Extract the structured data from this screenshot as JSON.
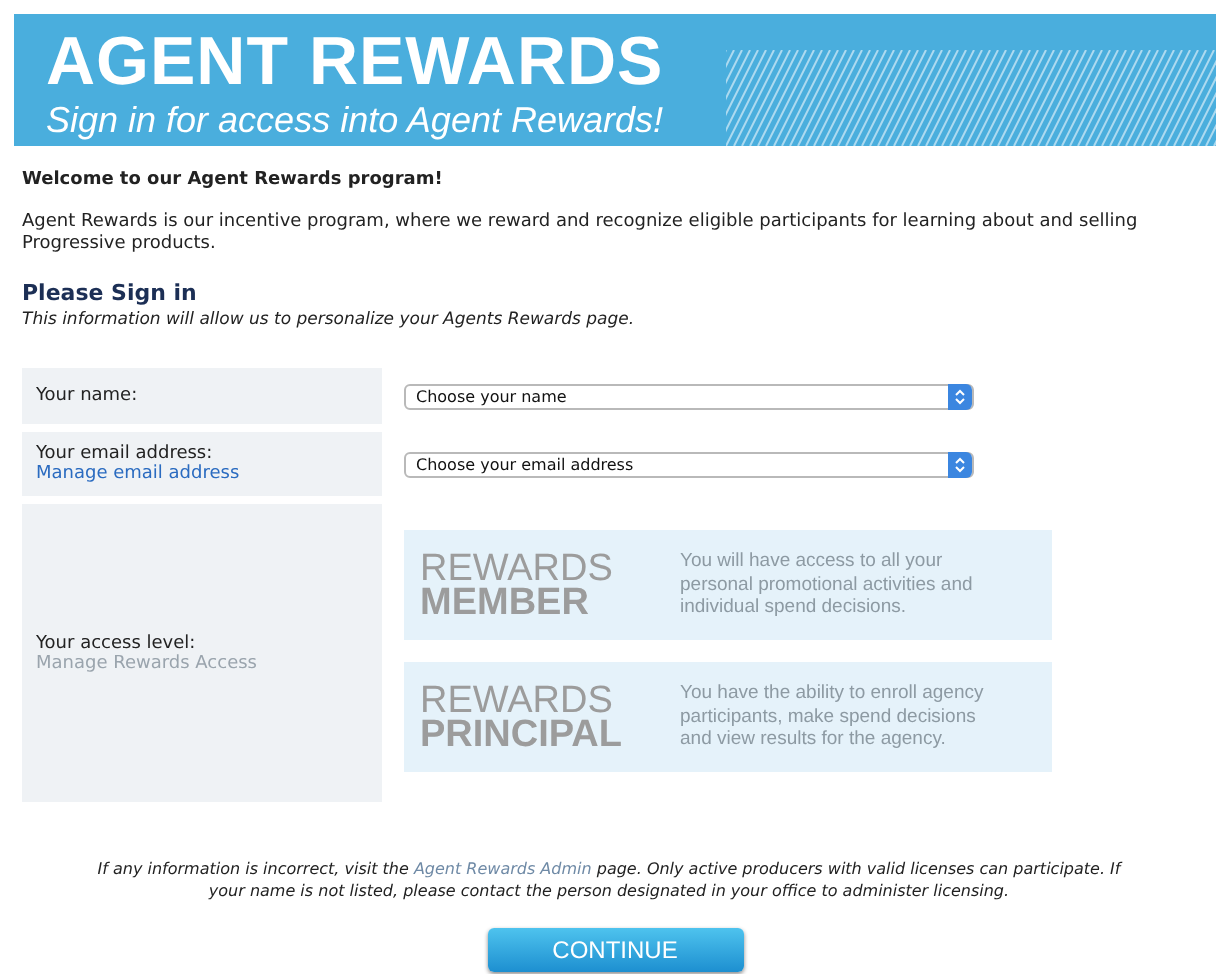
{
  "banner": {
    "title": "AGENT REWARDS",
    "subtitle": "Sign in for access into Agent Rewards!"
  },
  "welcome": "Welcome to our Agent Rewards program!",
  "intro": "Agent Rewards is our incentive program, where we reward and recognize eligible participants for learning about and selling Progressive products.",
  "sign_in": {
    "heading": "Please Sign in",
    "subheading": "This information will allow us to personalize your Agents Rewards page."
  },
  "form": {
    "name": {
      "label": "Your name:",
      "value": "Choose your name"
    },
    "email": {
      "label": "Your email address:",
      "link": "Manage email address",
      "value": "Choose your email address"
    },
    "access": {
      "label": "Your access level:",
      "link": "Manage Rewards Access",
      "link_disabled": true,
      "options": [
        {
          "title_light": "REWARDS",
          "title_bold": "MEMBER",
          "description": "You will have access to all your personal promotional activities and individual spend decisions.",
          "disabled": true
        },
        {
          "title_light": "REWARDS",
          "title_bold": "PRINCIPAL",
          "description": "You have the ability to enroll agency participants, make spend decisions and view results for the agency.",
          "disabled": true
        }
      ]
    }
  },
  "note": {
    "before": "If any information is incorrect, visit the ",
    "link": "Agent Rewards Admin",
    "after": " page. Only active producers with valid licenses can participate. If your name is not listed, please contact the person designated in your office to administer licensing."
  },
  "continue_button": "CONTINUE"
}
